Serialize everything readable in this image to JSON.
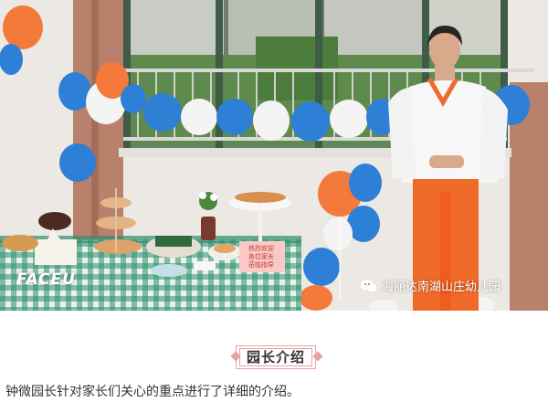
{
  "photo": {
    "faceu_mark": "FACEU",
    "watermark_text": "海丽达南湖山庄幼儿园",
    "watermark_icon": "wechat-icon",
    "table_sign_lines": [
      "热烈欢迎",
      "各位家长",
      "莅临指导"
    ],
    "colors": {
      "balloon_blue": "#2e7fd6",
      "balloon_orange": "#f47a3c",
      "balloon_white": "#f4f4f4",
      "tablecloth_green": "#2f8f6d",
      "uniform_orange": "#f06a2a"
    }
  },
  "section": {
    "title": "园长介绍"
  },
  "caption": {
    "text": "钟微园长针对家长们关心的重点进行了详细的介绍。"
  }
}
